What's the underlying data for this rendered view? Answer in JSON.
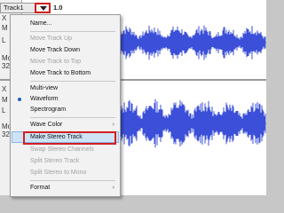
{
  "track1": {
    "name": "Track1",
    "scale_label": "1.0",
    "ctrl_labels": [
      "X",
      "M",
      "L",
      "",
      "Mo",
      "32-"
    ]
  },
  "track2": {
    "ctrl_labels": [
      "X",
      "M",
      "L",
      "",
      "Mo",
      "32-"
    ]
  },
  "menu": {
    "items": [
      {
        "label": "Name...",
        "state": "enabled"
      },
      {
        "label": "Move Track Up",
        "state": "disabled"
      },
      {
        "label": "Move Track Down",
        "state": "enabled"
      },
      {
        "label": "Move Track to Top",
        "state": "disabled"
      },
      {
        "label": "Move Track to Bottom",
        "state": "enabled"
      },
      {
        "label": "Multi-view",
        "state": "enabled"
      },
      {
        "label": "Waveform",
        "state": "enabled",
        "selected": true
      },
      {
        "label": "Spectrogram",
        "state": "enabled"
      },
      {
        "label": "Wave Color",
        "state": "enabled",
        "submenu": true
      },
      {
        "label": "Make Stereo Track",
        "state": "enabled",
        "highlighted": true
      },
      {
        "label": "Swap Stereo Channels",
        "state": "disabled"
      },
      {
        "label": "Split Stereo Track",
        "state": "disabled"
      },
      {
        "label": "Split Stereo to Mono",
        "state": "disabled"
      },
      {
        "label": "Format",
        "state": "enabled",
        "submenu": true
      }
    ],
    "submenu_arrow": "›"
  },
  "colors": {
    "waveform": "#3b4fd8",
    "annotation_red": "#d21f1f",
    "highlight": "#cfe3f7"
  }
}
